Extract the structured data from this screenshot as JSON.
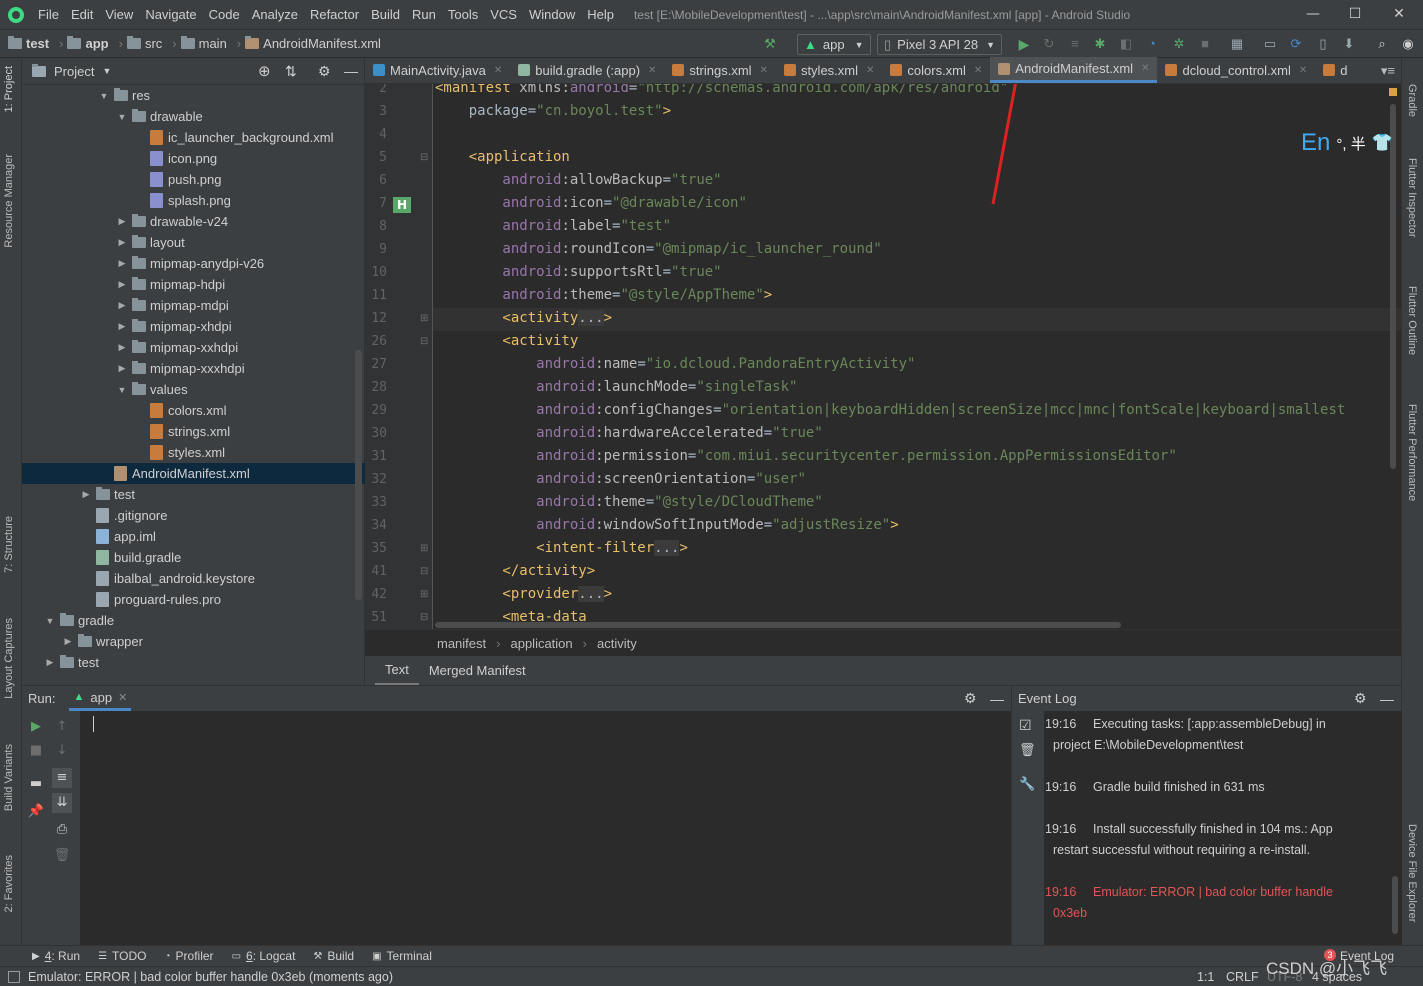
{
  "menu": [
    "File",
    "Edit",
    "View",
    "Navigate",
    "Code",
    "Analyze",
    "Refactor",
    "Build",
    "Run",
    "Tools",
    "VCS",
    "Window",
    "Help"
  ],
  "window_title": "test [E:\\MobileDevelopment\\test] - ...\\app\\src\\main\\AndroidManifest.xml [app] - Android Studio",
  "nav": {
    "crumbs": [
      "test",
      "app",
      "src",
      "main",
      "AndroidManifest.xml"
    ],
    "config": "app",
    "device": "Pixel 3 API 28"
  },
  "project": {
    "title": "Project",
    "tree": [
      {
        "label": "res",
        "depth": 4,
        "icon": "folder",
        "arrow": "▼"
      },
      {
        "label": "drawable",
        "depth": 5,
        "icon": "folder",
        "arrow": "▼"
      },
      {
        "label": "ic_launcher_background.xml",
        "depth": 6,
        "icon": "xml",
        "arrow": ""
      },
      {
        "label": "icon.png",
        "depth": 6,
        "icon": "png",
        "arrow": ""
      },
      {
        "label": "push.png",
        "depth": 6,
        "icon": "png",
        "arrow": ""
      },
      {
        "label": "splash.png",
        "depth": 6,
        "icon": "png",
        "arrow": ""
      },
      {
        "label": "drawable-v24",
        "depth": 5,
        "icon": "folder",
        "arrow": "▶"
      },
      {
        "label": "layout",
        "depth": 5,
        "icon": "folder",
        "arrow": "▶"
      },
      {
        "label": "mipmap-anydpi-v26",
        "depth": 5,
        "icon": "folder",
        "arrow": "▶"
      },
      {
        "label": "mipmap-hdpi",
        "depth": 5,
        "icon": "folder",
        "arrow": "▶"
      },
      {
        "label": "mipmap-mdpi",
        "depth": 5,
        "icon": "folder",
        "arrow": "▶"
      },
      {
        "label": "mipmap-xhdpi",
        "depth": 5,
        "icon": "folder",
        "arrow": "▶"
      },
      {
        "label": "mipmap-xxhdpi",
        "depth": 5,
        "icon": "folder",
        "arrow": "▶"
      },
      {
        "label": "mipmap-xxxhdpi",
        "depth": 5,
        "icon": "folder",
        "arrow": "▶"
      },
      {
        "label": "values",
        "depth": 5,
        "icon": "folder",
        "arrow": "▼"
      },
      {
        "label": "colors.xml",
        "depth": 6,
        "icon": "xml",
        "arrow": ""
      },
      {
        "label": "strings.xml",
        "depth": 6,
        "icon": "xml",
        "arrow": ""
      },
      {
        "label": "styles.xml",
        "depth": 6,
        "icon": "xml",
        "arrow": ""
      },
      {
        "label": "AndroidManifest.xml",
        "depth": 4,
        "icon": "manifest",
        "arrow": "",
        "selected": true
      },
      {
        "label": "test",
        "depth": 3,
        "icon": "folder",
        "arrow": "▶"
      },
      {
        "label": ".gitignore",
        "depth": 3,
        "icon": "file",
        "arrow": ""
      },
      {
        "label": "app.iml",
        "depth": 3,
        "icon": "iml",
        "arrow": ""
      },
      {
        "label": "build.gradle",
        "depth": 3,
        "icon": "grad",
        "arrow": ""
      },
      {
        "label": "ibalbal_android.keystore",
        "depth": 3,
        "icon": "file",
        "arrow": ""
      },
      {
        "label": "proguard-rules.pro",
        "depth": 3,
        "icon": "file",
        "arrow": ""
      },
      {
        "label": "gradle",
        "depth": 1,
        "icon": "folder",
        "arrow": "▼"
      },
      {
        "label": "wrapper",
        "depth": 2,
        "icon": "folder",
        "arrow": "▶"
      },
      {
        "label": "test",
        "depth": 1,
        "icon": "folder",
        "arrow": "▶"
      }
    ]
  },
  "editor_tabs": [
    {
      "label": "MainActivity.java",
      "color": "#3d8fc7",
      "active": false
    },
    {
      "label": "build.gradle (:app)",
      "color": "#8fb6a0",
      "active": false
    },
    {
      "label": "strings.xml",
      "color": "#c77c3e",
      "active": false
    },
    {
      "label": "styles.xml",
      "color": "#c77c3e",
      "active": false
    },
    {
      "label": "colors.xml",
      "color": "#c77c3e",
      "active": false
    },
    {
      "label": "AndroidManifest.xml",
      "color": "#b09070",
      "active": true
    },
    {
      "label": "dcloud_control.xml",
      "color": "#c77c3e",
      "active": false
    },
    {
      "label": "d",
      "color": "#c77c3e",
      "active": false
    }
  ],
  "code_lines": [
    {
      "n": "2",
      "parts": [
        [
          "tag",
          "<manifest "
        ],
        [
          "attr",
          "xmlns:"
        ],
        [
          "ns",
          "android"
        ],
        [
          "txt",
          "="
        ],
        [
          "val",
          "\"http://schemas.android.com/apk/res/android\""
        ]
      ]
    },
    {
      "n": "3",
      "parts": [
        [
          "txt",
          "    package="
        ],
        [
          "val",
          "\"cn.boyol.test\""
        ],
        [
          "tag",
          ">"
        ]
      ]
    },
    {
      "n": "4",
      "parts": []
    },
    {
      "n": "5",
      "parts": [
        [
          "tag",
          "    <application"
        ]
      ]
    },
    {
      "n": "6",
      "parts": [
        [
          "ns",
          "        android"
        ],
        [
          "attr",
          ":allowBackup"
        ],
        [
          "txt",
          "="
        ],
        [
          "val",
          "\"true\""
        ]
      ]
    },
    {
      "n": "7",
      "parts": [
        [
          "ns",
          "        android"
        ],
        [
          "attr",
          ":icon"
        ],
        [
          "txt",
          "="
        ],
        [
          "val",
          "\"@drawable/icon\""
        ]
      ]
    },
    {
      "n": "8",
      "parts": [
        [
          "ns",
          "        android"
        ],
        [
          "attr",
          ":label"
        ],
        [
          "txt",
          "="
        ],
        [
          "val",
          "\"test\""
        ]
      ]
    },
    {
      "n": "9",
      "parts": [
        [
          "ns",
          "        android"
        ],
        [
          "attr",
          ":roundIcon"
        ],
        [
          "txt",
          "="
        ],
        [
          "val",
          "\"@mipmap/ic_launcher_round\""
        ]
      ]
    },
    {
      "n": "10",
      "parts": [
        [
          "ns",
          "        android"
        ],
        [
          "attr",
          ":supportsRtl"
        ],
        [
          "txt",
          "="
        ],
        [
          "val",
          "\"true\""
        ]
      ]
    },
    {
      "n": "11",
      "parts": [
        [
          "ns",
          "        android"
        ],
        [
          "attr",
          ":theme"
        ],
        [
          "txt",
          "="
        ],
        [
          "val",
          "\"@style/AppTheme\""
        ],
        [
          "tag",
          ">"
        ]
      ]
    },
    {
      "n": "12",
      "parts": [
        [
          "tag",
          "        <activity"
        ],
        [
          "fold",
          "..."
        ],
        [
          "tag",
          ">"
        ]
      ]
    },
    {
      "n": "26",
      "parts": [
        [
          "tag",
          "        <activity"
        ]
      ]
    },
    {
      "n": "27",
      "parts": [
        [
          "ns",
          "            android"
        ],
        [
          "attr",
          ":name"
        ],
        [
          "txt",
          "="
        ],
        [
          "val",
          "\"io.dcloud.PandoraEntryActivity\""
        ]
      ]
    },
    {
      "n": "28",
      "parts": [
        [
          "ns",
          "            android"
        ],
        [
          "attr",
          ":launchMode"
        ],
        [
          "txt",
          "="
        ],
        [
          "val",
          "\"singleTask\""
        ]
      ]
    },
    {
      "n": "29",
      "parts": [
        [
          "ns",
          "            android"
        ],
        [
          "attr",
          ":configChanges"
        ],
        [
          "txt",
          "="
        ],
        [
          "val",
          "\"orientation|keyboardHidden|screenSize|mcc|mnc|fontScale|keyboard|smallest"
        ]
      ]
    },
    {
      "n": "30",
      "parts": [
        [
          "ns",
          "            android"
        ],
        [
          "attr",
          ":hardwareAccelerated"
        ],
        [
          "txt",
          "="
        ],
        [
          "val",
          "\"true\""
        ]
      ]
    },
    {
      "n": "31",
      "parts": [
        [
          "ns",
          "            android"
        ],
        [
          "attr",
          ":permission"
        ],
        [
          "txt",
          "="
        ],
        [
          "val",
          "\"com.miui.securitycenter.permission.AppPermissionsEditor\""
        ]
      ]
    },
    {
      "n": "32",
      "parts": [
        [
          "ns",
          "            android"
        ],
        [
          "attr",
          ":screenOrientation"
        ],
        [
          "txt",
          "="
        ],
        [
          "val",
          "\"user\""
        ]
      ]
    },
    {
      "n": "33",
      "parts": [
        [
          "ns",
          "            android"
        ],
        [
          "attr",
          ":theme"
        ],
        [
          "txt",
          "="
        ],
        [
          "val",
          "\"@style/DCloudTheme\""
        ]
      ]
    },
    {
      "n": "34",
      "parts": [
        [
          "ns",
          "            android"
        ],
        [
          "attr",
          ":windowSoftInputMode"
        ],
        [
          "txt",
          "="
        ],
        [
          "val",
          "\"adjustResize\""
        ],
        [
          "tag",
          ">"
        ]
      ]
    },
    {
      "n": "35",
      "parts": [
        [
          "tag",
          "            <intent-filter"
        ],
        [
          "fold",
          "..."
        ],
        [
          "tag",
          ">"
        ]
      ]
    },
    {
      "n": "41",
      "parts": [
        [
          "tag",
          "        </activity>"
        ]
      ]
    },
    {
      "n": "42",
      "parts": [
        [
          "tag",
          "        <provider"
        ],
        [
          "fold",
          "..."
        ],
        [
          "tag",
          ">"
        ]
      ]
    },
    {
      "n": "51",
      "parts": [
        [
          "tag",
          "        <meta-data"
        ]
      ]
    }
  ],
  "editor_breadcrumb": [
    "manifest",
    "application",
    "activity"
  ],
  "editor_bottom_tabs": [
    "Text",
    "Merged Manifest"
  ],
  "ime": {
    "lang": "En",
    "symbols": "°, 半"
  },
  "run": {
    "label": "Run:",
    "config": "app"
  },
  "event_log": {
    "title": "Event Log",
    "entries": [
      {
        "time": "19:16",
        "text": "Executing tasks: [:app:assembleDebug] in",
        "cont": "project E:\\MobileDevelopment\\test",
        "error": false
      },
      {
        "time": "19:16",
        "text": "Gradle build finished in 631 ms",
        "cont": "",
        "error": false
      },
      {
        "time": "19:16",
        "text": "Install successfully finished in 104 ms.: App",
        "cont": "restart successful without requiring a re-install.",
        "error": false
      },
      {
        "time": "19:16",
        "text": "Emulator: ERROR   | bad color buffer handle",
        "cont": "0x3eb",
        "error": true
      }
    ]
  },
  "tool_windows": [
    {
      "key": "4",
      "label": ": Run"
    },
    {
      "key": "",
      "label": "TODO"
    },
    {
      "key": "",
      "label": "Profiler"
    },
    {
      "key": "6",
      "label": ": Logcat"
    },
    {
      "key": "",
      "label": "Build"
    },
    {
      "key": "",
      "label": "Terminal"
    }
  ],
  "event_log_badge": {
    "count": "3",
    "label": "Event Log"
  },
  "status": {
    "message": "Emulator: ERROR   | bad color buffer handle 0x3eb (moments ago)",
    "position": "1:1",
    "line_sep": "CRLF",
    "encoding": "UTF-8",
    "indent": "4 spaces",
    "watermark": "CSDN @小飞飞"
  },
  "left_tabs": [
    "1: Project",
    "Resource Manager",
    "7: Structure",
    "Layout Captures",
    "Build Variants",
    "2: Favorites"
  ],
  "right_tabs": [
    "Gradle",
    "Flutter Inspector",
    "Flutter Outline",
    "Flutter Performance",
    "Device File Explorer"
  ]
}
